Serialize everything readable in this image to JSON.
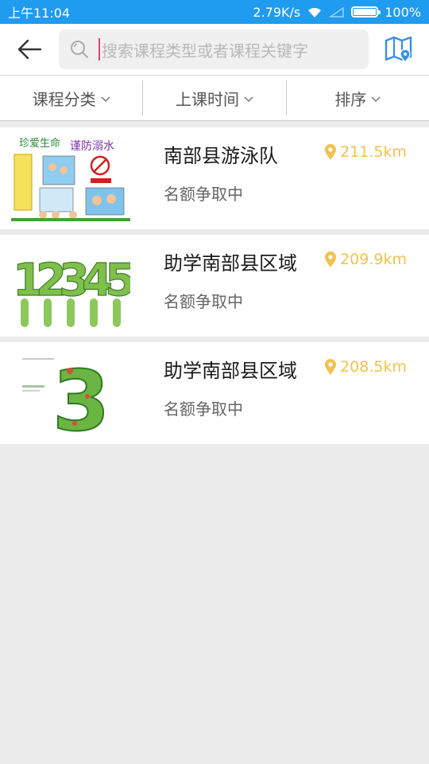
{
  "status_bar": {
    "time": "上午11:04",
    "speed": "2.79K/s",
    "battery": "100%"
  },
  "search": {
    "placeholder": "搜索课程类型或者课程关键字"
  },
  "filters": [
    {
      "label": "课程分类"
    },
    {
      "label": "上课时间"
    },
    {
      "label": "排序"
    }
  ],
  "courses": [
    {
      "title": "南部县游泳队",
      "status": "名额争取中",
      "distance": "211.5km",
      "thumb_text": [
        "珍爱生命",
        "谨防溺水"
      ]
    },
    {
      "title": "助学南部县区域",
      "status": "名额争取中",
      "distance": "209.9km",
      "thumb_text": [
        "1",
        "2",
        "3",
        "4",
        "5"
      ]
    },
    {
      "title": "助学南部县区域",
      "status": "名额争取中",
      "distance": "208.5km",
      "thumb_text": [
        "3"
      ]
    }
  ],
  "colors": {
    "statusbar": "#1f9bf0",
    "accent_distance": "#f2c14e",
    "map_icon": "#3a8ee8"
  }
}
